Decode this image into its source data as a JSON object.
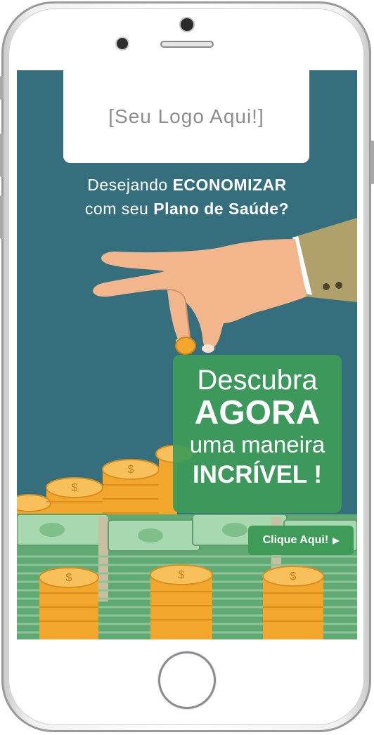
{
  "logo": {
    "text": "[Seu Logo Aqui!]"
  },
  "headline": {
    "line1_pre": "Desejando ",
    "line1_bold": "ECONOMIZAR",
    "line2_pre": "com seu ",
    "line2_bold": "Plano de Saúde?"
  },
  "promo": {
    "line1": "Descubra",
    "line2": "AGORA",
    "line3": "uma maneira",
    "line4": "INCRÍVEL !"
  },
  "cta": {
    "label": "Clique Aqui!",
    "icon": "play-arrow-icon"
  },
  "colors": {
    "screen_bg": "#356f7d",
    "promo_green": "#3e9c58",
    "coin_gold": "#f2a62c",
    "money_green": "#7fc08a",
    "suit": "#b0a06a",
    "skin": "#f3b58c"
  }
}
